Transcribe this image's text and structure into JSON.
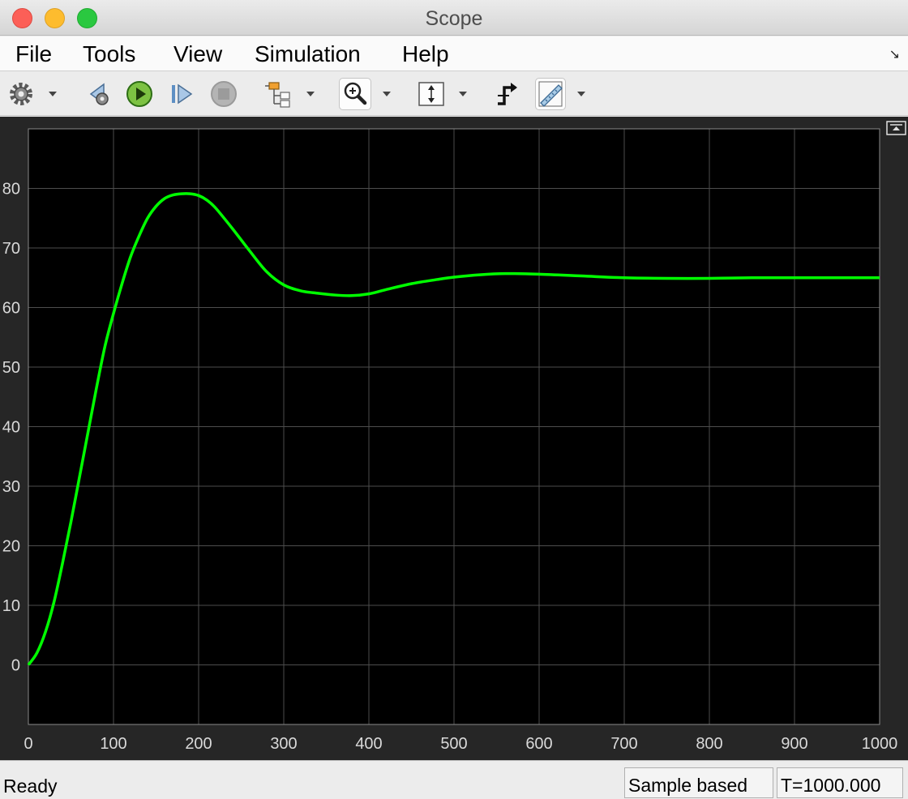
{
  "window": {
    "title": "Scope"
  },
  "menu": {
    "items": [
      "File",
      "Tools",
      "View",
      "Simulation",
      "Help"
    ]
  },
  "toolbar": {
    "icons": [
      "gear-icon",
      "step-back-icon",
      "run-icon",
      "step-forward-icon",
      "stop-icon",
      "signal-hierarchy-icon",
      "zoom-in-icon",
      "scale-axes-icon",
      "triggers-icon",
      "measurements-icon"
    ]
  },
  "colors": {
    "plot_bg": "#000000",
    "frame_bg": "#262626",
    "grid": "#4d4d4d",
    "line": "#00ff00",
    "tick_text": "#d9d9d9"
  },
  "chart_data": {
    "type": "line",
    "title": "",
    "xlabel": "",
    "ylabel": "",
    "xlim": [
      0,
      1000
    ],
    "ylim": [
      -10,
      90
    ],
    "xticks": [
      0,
      100,
      200,
      300,
      400,
      500,
      600,
      700,
      800,
      900,
      1000
    ],
    "yticks": [
      0,
      10,
      20,
      30,
      40,
      50,
      60,
      70,
      80
    ],
    "grid": true,
    "series": [
      {
        "color": "#00ff00",
        "x": [
          0,
          10,
          20,
          30,
          40,
          50,
          60,
          70,
          80,
          90,
          100,
          110,
          120,
          130,
          140,
          150,
          160,
          170,
          180,
          190,
          200,
          210,
          220,
          240,
          260,
          280,
          300,
          320,
          340,
          360,
          380,
          400,
          420,
          450,
          480,
          500,
          530,
          560,
          600,
          650,
          700,
          750,
          800,
          850,
          900,
          950,
          1000
        ],
        "y": [
          0,
          2,
          5.5,
          10.5,
          17,
          24,
          31.5,
          39,
          46.5,
          53.5,
          59,
          64,
          68.5,
          72,
          75,
          77,
          78.3,
          78.9,
          79.1,
          79.1,
          78.8,
          78,
          76.7,
          73.2,
          69.5,
          66,
          63.8,
          62.8,
          62.4,
          62.1,
          62.0,
          62.3,
          63,
          64,
          64.7,
          65.1,
          65.5,
          65.7,
          65.6,
          65.3,
          65.0,
          64.9,
          64.9,
          65.0,
          65.0,
          65.0,
          65.0
        ]
      }
    ]
  },
  "status": {
    "text": "Ready",
    "mode": "Sample based",
    "time": "T=1000.000"
  }
}
